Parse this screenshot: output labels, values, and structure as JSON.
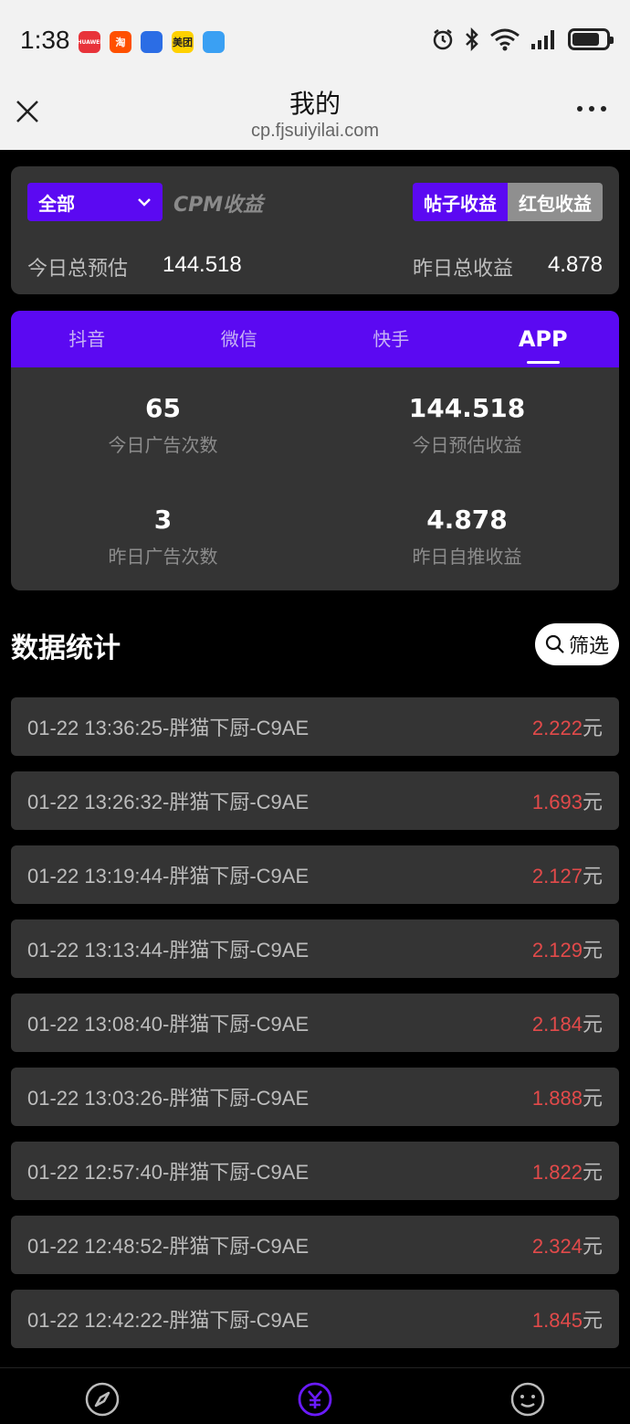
{
  "status_bar": {
    "time": "1:38",
    "app_icons": [
      {
        "name": "huawei-icon",
        "label": "HUAWEI",
        "color": "#e8333a"
      },
      {
        "name": "taobao-icon",
        "label": "淘",
        "color": "#ff5000"
      },
      {
        "name": "compass-app-icon",
        "label": "",
        "color": "#2b6de5"
      },
      {
        "name": "meituan-icon",
        "label": "美团",
        "color": "#ffd100"
      },
      {
        "name": "cloud-app-icon",
        "label": "",
        "color": "#3aa0f3"
      }
    ]
  },
  "browser": {
    "title": "我的",
    "url": "cp.fjsuiyilai.com"
  },
  "summary": {
    "dropdown_value": "全部",
    "cpm_label": "CPM收益",
    "toggle": {
      "active": "帖子收益",
      "inactive": "红包收益"
    },
    "today_label": "今日总预估",
    "today_value": "144.518",
    "yesterday_label": "昨日总收益",
    "yesterday_value": "4.878"
  },
  "platform": {
    "tabs": [
      {
        "label": "抖音",
        "active": false
      },
      {
        "label": "微信",
        "active": false
      },
      {
        "label": "快手",
        "active": false
      },
      {
        "label": "APP",
        "active": true
      }
    ],
    "stats": [
      {
        "value": "65",
        "label": "今日广告次数"
      },
      {
        "value": "144.518",
        "label": "今日预估收益"
      },
      {
        "value": "3",
        "label": "昨日广告次数"
      },
      {
        "value": "4.878",
        "label": "昨日自推收益"
      }
    ]
  },
  "data_section": {
    "title": "数据统计",
    "filter_label": "筛选"
  },
  "records": [
    {
      "text": "01-22 13:36:25-胖猫下厨-C9AE",
      "amount": "2.222",
      "unit": "元"
    },
    {
      "text": "01-22 13:26:32-胖猫下厨-C9AE",
      "amount": "1.693",
      "unit": "元"
    },
    {
      "text": "01-22 13:19:44-胖猫下厨-C9AE",
      "amount": "2.127",
      "unit": "元"
    },
    {
      "text": "01-22 13:13:44-胖猫下厨-C9AE",
      "amount": "2.129",
      "unit": "元"
    },
    {
      "text": "01-22 13:08:40-胖猫下厨-C9AE",
      "amount": "2.184",
      "unit": "元"
    },
    {
      "text": "01-22 13:03:26-胖猫下厨-C9AE",
      "amount": "1.888",
      "unit": "元"
    },
    {
      "text": "01-22 12:57:40-胖猫下厨-C9AE",
      "amount": "1.822",
      "unit": "元"
    },
    {
      "text": "01-22 12:48:52-胖猫下厨-C9AE",
      "amount": "2.324",
      "unit": "元"
    },
    {
      "text": "01-22 12:42:22-胖猫下厨-C9AE",
      "amount": "1.845",
      "unit": "元"
    }
  ],
  "bottom_nav": [
    {
      "name": "nav-discover",
      "icon": "compass-icon",
      "active": false
    },
    {
      "name": "nav-earnings",
      "icon": "yuan-icon",
      "active": true
    },
    {
      "name": "nav-profile",
      "icon": "smiley-icon",
      "active": false
    }
  ],
  "colors": {
    "accent": "#5b09f2",
    "amount": "#e24a4a",
    "card": "#343434"
  }
}
